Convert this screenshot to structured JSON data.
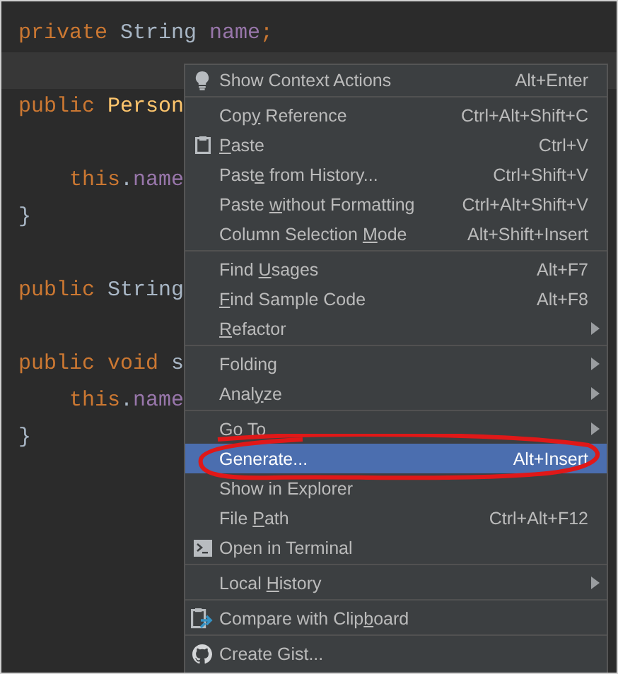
{
  "editor": {
    "lines": [
      {
        "current": false,
        "tokens": [
          {
            "text": "private",
            "kind": "keyword"
          },
          {
            "text": " String",
            "kind": "type"
          },
          {
            "text": " name",
            "kind": "field"
          },
          {
            "text": ";",
            "kind": "keyword"
          }
        ]
      },
      {
        "current": true
      },
      {
        "current": false,
        "tokens": [
          {
            "text": "public",
            "kind": "keyword"
          },
          {
            "text": " Person",
            "kind": "method"
          }
        ]
      },
      {
        "current": false
      },
      {
        "current": false,
        "tokens": [
          {
            "text": "    this",
            "kind": "keyword"
          },
          {
            "text": ".",
            "kind": "type"
          },
          {
            "text": "name",
            "kind": "field"
          }
        ]
      },
      {
        "current": false,
        "tokens": [
          {
            "text": "}",
            "kind": "type"
          }
        ]
      },
      {
        "current": false
      },
      {
        "current": false,
        "tokens": [
          {
            "text": "public",
            "kind": "keyword"
          },
          {
            "text": " String",
            "kind": "type"
          }
        ]
      },
      {
        "current": false
      },
      {
        "current": false,
        "tokens": [
          {
            "text": "public",
            "kind": "keyword"
          },
          {
            "text": " void",
            "kind": "keyword"
          },
          {
            "text": " s",
            "kind": "type"
          }
        ]
      },
      {
        "current": false,
        "tokens": [
          {
            "text": "    this",
            "kind": "keyword"
          },
          {
            "text": ".",
            "kind": "type"
          },
          {
            "text": "name",
            "kind": "field"
          }
        ]
      },
      {
        "current": false,
        "tokens": [
          {
            "text": "}",
            "kind": "type"
          }
        ]
      }
    ]
  },
  "context_menu": {
    "groups": [
      [
        {
          "label": [
            "Show Context Actions"
          ],
          "shortcut": "Alt+Enter",
          "submenu": false,
          "selected": false,
          "circled": false
        }
      ],
      [
        {
          "label": [
            "Cop",
            "y",
            " Reference"
          ],
          "shortcut": "Ctrl+Alt+Shift+C",
          "submenu": false,
          "selected": false,
          "circled": false
        },
        {
          "label": [
            "P",
            "aste"
          ],
          "shortcut": "Ctrl+V",
          "submenu": false,
          "selected": false,
          "circled": false
        },
        {
          "label": [
            "Past",
            "e",
            " from History..."
          ],
          "shortcut": "Ctrl+Shift+V",
          "submenu": false,
          "selected": false,
          "circled": false
        },
        {
          "label": [
            "Paste ",
            "w",
            "ithout Formatting"
          ],
          "shortcut": "Ctrl+Alt+Shift+V",
          "submenu": false,
          "selected": false,
          "circled": false
        },
        {
          "label": [
            "Column Selection ",
            "M",
            "ode"
          ],
          "shortcut": "Alt+Shift+Insert",
          "submenu": false,
          "selected": false,
          "circled": false
        }
      ],
      [
        {
          "label": [
            "Find ",
            "U",
            "sages"
          ],
          "shortcut": "Alt+F7",
          "submenu": false,
          "selected": false,
          "circled": false
        },
        {
          "label": [
            "F",
            "ind Sample Code"
          ],
          "shortcut": "Alt+F8",
          "submenu": false,
          "selected": false,
          "circled": false
        },
        {
          "label": [
            "R",
            "efactor"
          ],
          "submenu": true,
          "selected": false,
          "circled": false
        }
      ],
      [
        {
          "label": [
            "Folding"
          ],
          "submenu": true,
          "selected": false,
          "circled": false
        },
        {
          "label": [
            "Anal",
            "y",
            "ze"
          ],
          "submenu": true,
          "selected": false,
          "circled": false
        }
      ],
      [
        {
          "label": [
            "Go To"
          ],
          "submenu": true,
          "selected": false,
          "circled": false
        },
        {
          "label": [
            "Generate..."
          ],
          "shortcut": "Alt+Insert",
          "submenu": false,
          "selected": true,
          "circled": true
        },
        {
          "label": [
            "Show in Explorer"
          ],
          "submenu": false,
          "selected": false,
          "circled": false
        },
        {
          "label": [
            "File ",
            "P",
            "ath"
          ],
          "shortcut": "Ctrl+Alt+F12",
          "submenu": false,
          "selected": false,
          "circled": false
        },
        {
          "label": [
            "Open in Terminal"
          ],
          "submenu": false,
          "selected": false,
          "circled": false
        }
      ],
      [
        {
          "label": [
            "Local ",
            "H",
            "istory"
          ],
          "submenu": true,
          "selected": false,
          "circled": false
        }
      ],
      [
        {
          "label": [
            "Compare with Clip",
            "b",
            "oard"
          ],
          "submenu": false,
          "selected": false,
          "circled": false
        }
      ],
      [
        {
          "label": [
            "Create Gist..."
          ],
          "submenu": false,
          "selected": false,
          "circled": false
        }
      ]
    ]
  }
}
